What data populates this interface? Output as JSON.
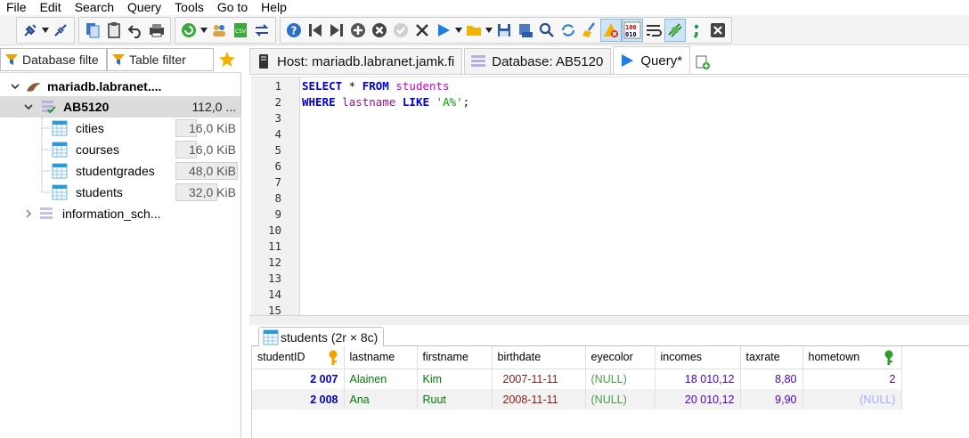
{
  "menu": [
    "File",
    "Edit",
    "Search",
    "Query",
    "Tools",
    "Go to",
    "Help"
  ],
  "toolbar": {
    "icons": [
      "connect-icon",
      "disconnect-icon",
      "copy-icon",
      "paste-icon",
      "undo-icon",
      "print-icon",
      "refresh-icon",
      "user-manager-icon",
      "export-csv-icon",
      "transfer-icon",
      "help-icon",
      "first-icon",
      "last-icon",
      "add-icon",
      "cancel-icon",
      "check-icon",
      "delete-icon",
      "run-icon",
      "open-file-icon",
      "save-icon",
      "save-snippet-icon",
      "find-icon",
      "find-replace-icon",
      "clear-icon",
      "warning-icon",
      "binary-icon",
      "wrap-icon",
      "shape-icon",
      "semicolon-icon",
      "stop-icon"
    ]
  },
  "filters": {
    "database_placeholder": "Database filte",
    "table_placeholder": "Table filter"
  },
  "tree": {
    "server": "mariadb.labranet....",
    "database": "AB5120",
    "database_size": "112,0 ...",
    "tables": [
      {
        "name": "cities",
        "size": "16,0 KiB"
      },
      {
        "name": "courses",
        "size": "16,0 KiB"
      },
      {
        "name": "studentgrades",
        "size": "48,0 KiB"
      },
      {
        "name": "students",
        "size": "32,0 KiB"
      }
    ],
    "other_db": "information_sch..."
  },
  "tabs": {
    "host": "Host: mariadb.labranet.jamk.fi",
    "database": "Database: AB5120",
    "query": "Query*"
  },
  "editor": {
    "line_numbers": [
      "1",
      "2",
      "3",
      "4",
      "5",
      "6",
      "7",
      "8",
      "9",
      "10",
      "11",
      "12",
      "13",
      "14",
      "15"
    ],
    "line1": {
      "kw1": "SELECT",
      "star": " * ",
      "kw2": "FROM",
      "table": " students"
    },
    "line2": {
      "kw1": "WHERE",
      "col": " lastname ",
      "kw2": "LIKE",
      "str": " 'A%'",
      "end": ";"
    }
  },
  "results": {
    "tab_label": "students (2r × 8c)",
    "columns": [
      "studentID",
      "lastname",
      "firstname",
      "birthdate",
      "eyecolor",
      "incomes",
      "taxrate",
      "hometown"
    ],
    "rows": [
      [
        "2 007",
        "Alainen",
        "Kim",
        "2007-11-11",
        "(NULL)",
        "18 010,12",
        "8,80",
        "2"
      ],
      [
        "2 008",
        "Ana",
        "Ruut",
        "2008-11-11",
        "(NULL)",
        "20 010,12",
        "9,90",
        "(NULL)"
      ]
    ]
  },
  "colors": {
    "keyword": "#0000d8",
    "table_name": "#cc00cc",
    "string": "#00a000",
    "id_value": "#0000c8",
    "selection": "#dcdcdc"
  }
}
